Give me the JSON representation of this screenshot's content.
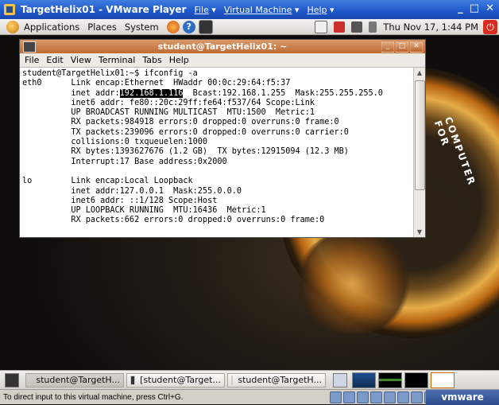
{
  "vmware": {
    "title": "TargetHelix01 - VMware Player",
    "menus": [
      "File",
      "Virtual Machine",
      "Help"
    ],
    "status_text": "To direct input to this virtual machine, press Ctrl+G.",
    "brand": "vmware"
  },
  "gnome_panel": {
    "menu_applications": "Applications",
    "menu_places": "Places",
    "menu_system": "System",
    "clock": "Thu Nov 17,  1:44 PM"
  },
  "desktop": {
    "emblem_text": "COMPUTER FOR"
  },
  "terminal": {
    "title": "student@TargetHelix01: ~",
    "menus": [
      "File",
      "Edit",
      "View",
      "Terminal",
      "Tabs",
      "Help"
    ],
    "lines_before_selection": "student@TargetHelix01:~$ ifconfig -a\neth0      Link encap:Ethernet  HWaddr 00:0c:29:64:f5:37\n          inet addr:",
    "selected_text": "192.168.1.116",
    "lines_after_selection": "  Bcast:192.168.1.255  Mask:255.255.255.0\n          inet6 addr: fe80::20c:29ff:fe64:f537/64 Scope:Link\n          UP BROADCAST RUNNING MULTICAST  MTU:1500  Metric:1\n          RX packets:984918 errors:0 dropped:0 overruns:0 frame:0\n          TX packets:239096 errors:0 dropped:0 overruns:0 carrier:0\n          collisions:0 txqueuelen:1000\n          RX bytes:1393627676 (1.2 GB)  TX bytes:12915094 (12.3 MB)\n          Interrupt:17 Base address:0x2000\n\nlo        Link encap:Local Loopback\n          inet addr:127.0.0.1  Mask:255.0.0.0\n          inet6 addr: ::1/128 Scope:Host\n          UP LOOPBACK RUNNING  MTU:16436  Metric:1\n          RX packets:662 errors:0 dropped:0 overruns:0 frame:0"
  },
  "taskbar": {
    "tasks": [
      "student@TargetH...",
      "[student@Target...",
      "student@TargetH..."
    ]
  }
}
